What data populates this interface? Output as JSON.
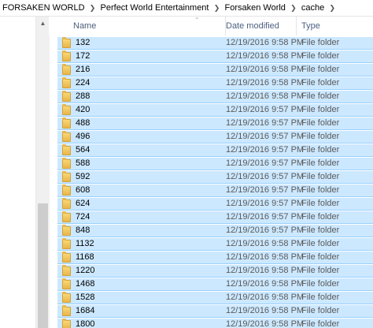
{
  "breadcrumb": {
    "items": [
      "FORSAKEN WORLD",
      "Perfect World Entertainment",
      "Forsaken World",
      "cache"
    ],
    "separator_icon": "chevron-right-icon"
  },
  "columns": {
    "name": "Name",
    "date_modified": "Date modified",
    "type": "Type"
  },
  "rows": [
    {
      "name": "132",
      "date": "12/19/2016 9:58 PM",
      "type": "File folder"
    },
    {
      "name": "172",
      "date": "12/19/2016 9:58 PM",
      "type": "File folder"
    },
    {
      "name": "216",
      "date": "12/19/2016 9:58 PM",
      "type": "File folder"
    },
    {
      "name": "224",
      "date": "12/19/2016 9:58 PM",
      "type": "File folder"
    },
    {
      "name": "288",
      "date": "12/19/2016 9:58 PM",
      "type": "File folder"
    },
    {
      "name": "420",
      "date": "12/19/2016 9:57 PM",
      "type": "File folder"
    },
    {
      "name": "488",
      "date": "12/19/2016 9:57 PM",
      "type": "File folder"
    },
    {
      "name": "496",
      "date": "12/19/2016 9:57 PM",
      "type": "File folder"
    },
    {
      "name": "564",
      "date": "12/19/2016 9:57 PM",
      "type": "File folder"
    },
    {
      "name": "588",
      "date": "12/19/2016 9:57 PM",
      "type": "File folder"
    },
    {
      "name": "592",
      "date": "12/19/2016 9:57 PM",
      "type": "File folder"
    },
    {
      "name": "608",
      "date": "12/19/2016 9:57 PM",
      "type": "File folder"
    },
    {
      "name": "624",
      "date": "12/19/2016 9:57 PM",
      "type": "File folder"
    },
    {
      "name": "724",
      "date": "12/19/2016 9:57 PM",
      "type": "File folder"
    },
    {
      "name": "848",
      "date": "12/19/2016 9:57 PM",
      "type": "File folder"
    },
    {
      "name": "1132",
      "date": "12/19/2016 9:58 PM",
      "type": "File folder"
    },
    {
      "name": "1168",
      "date": "12/19/2016 9:58 PM",
      "type": "File folder"
    },
    {
      "name": "1220",
      "date": "12/19/2016 9:58 PM",
      "type": "File folder"
    },
    {
      "name": "1468",
      "date": "12/19/2016 9:58 PM",
      "type": "File folder"
    },
    {
      "name": "1528",
      "date": "12/19/2016 9:58 PM",
      "type": "File folder"
    },
    {
      "name": "1684",
      "date": "12/19/2016 9:58 PM",
      "type": "File folder"
    },
    {
      "name": "1800",
      "date": "12/19/2016 9:58 PM",
      "type": "File folder"
    }
  ],
  "colors": {
    "selection_bg": "#cce8ff",
    "selection_border": "#99d1ff",
    "folder": "#e9b64a"
  }
}
